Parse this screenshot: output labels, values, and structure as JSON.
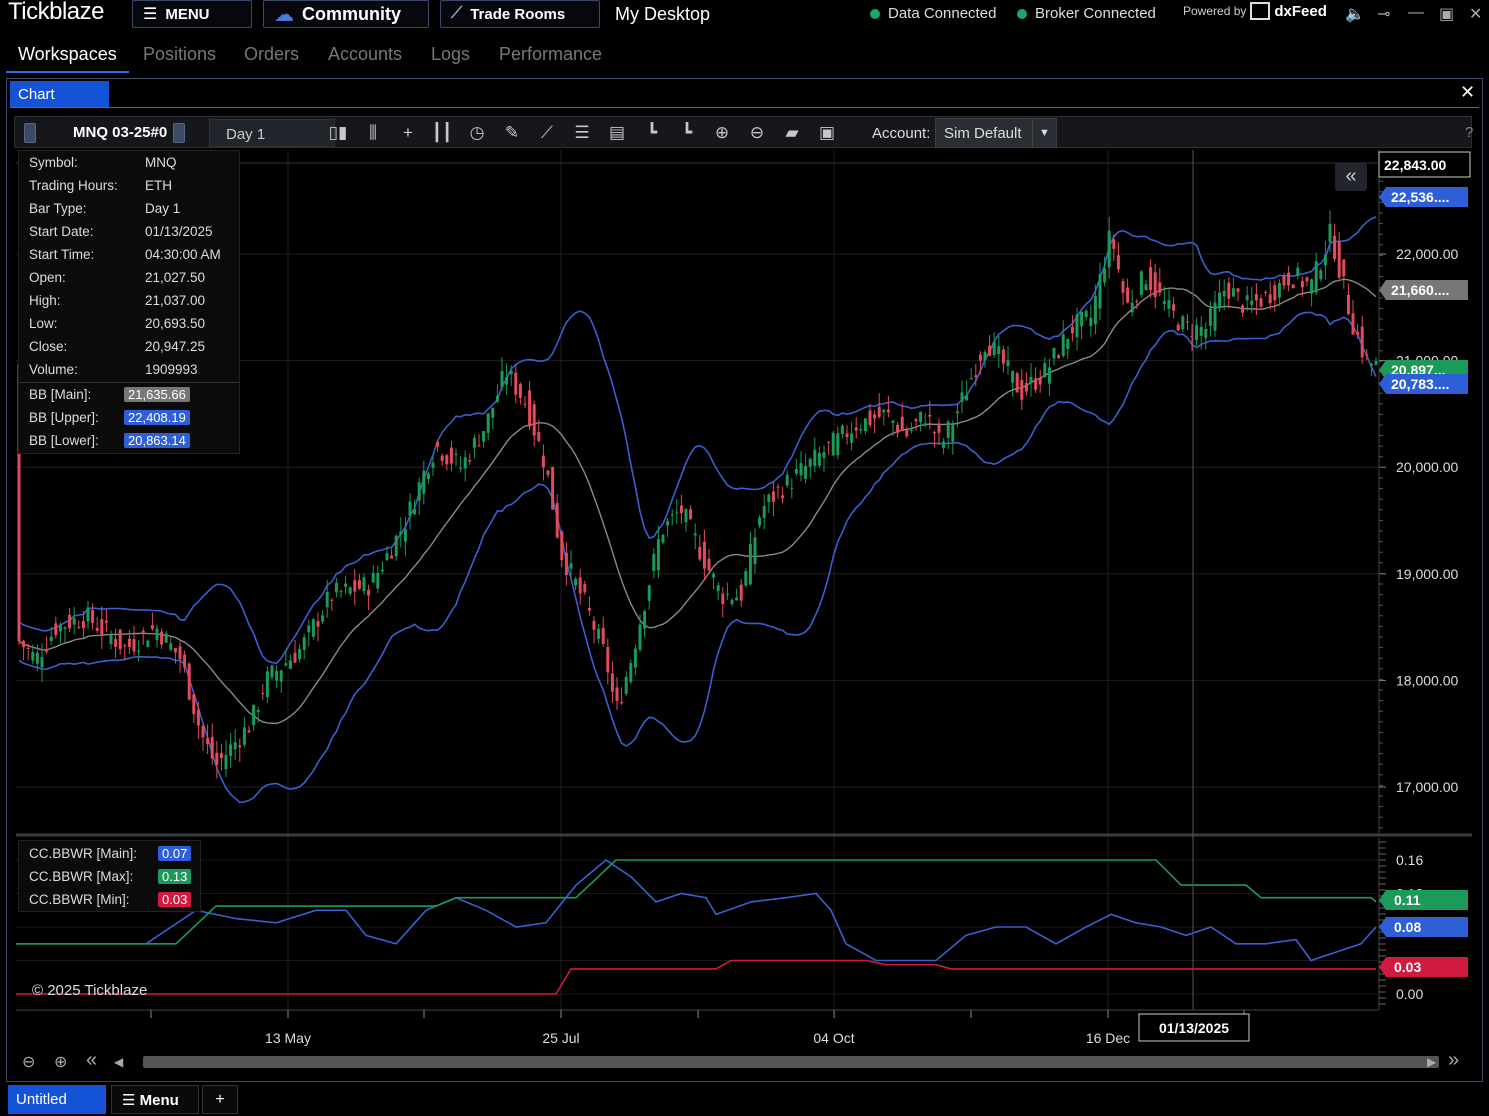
{
  "app": {
    "brand": "Tickblaze",
    "menu_label": "MENU",
    "community_label": "Community",
    "trade_rooms_label": "Trade Rooms",
    "desktop_label": "My Desktop",
    "data_status": "Data Connected",
    "broker_status": "Broker Connected",
    "powered_by": "Powered by",
    "feed_name": "dxFeed"
  },
  "nav_tabs": [
    "Workspaces",
    "Positions",
    "Orders",
    "Accounts",
    "Logs",
    "Performance"
  ],
  "chart_window": {
    "tab_label": "Chart",
    "symbol": "MNQ 03-25#0",
    "period": "Day 1",
    "account_label": "Account:",
    "account_value": "Sim Default",
    "help": "?"
  },
  "info_box": {
    "rows": [
      {
        "label": "Symbol:",
        "value": "MNQ"
      },
      {
        "label": "Trading Hours:",
        "value": "ETH"
      },
      {
        "label": "Bar Type:",
        "value": "Day 1"
      },
      {
        "label": "Start Date:",
        "value": "01/13/2025"
      },
      {
        "label": "Start Time:",
        "value": "04:30:00 AM"
      },
      {
        "label": "Open:",
        "value": "21,027.50"
      },
      {
        "label": "High:",
        "value": "21,037.00"
      },
      {
        "label": "Low:",
        "value": "20,693.50"
      },
      {
        "label": "Close:",
        "value": "20,947.25"
      },
      {
        "label": "Volume:",
        "value": "1909993"
      }
    ],
    "bb": [
      {
        "label": "BB [Main]:",
        "value": "21,635.66",
        "color": "#777777"
      },
      {
        "label": "BB [Upper]:",
        "value": "22,408.19",
        "color": "#2f5fd6"
      },
      {
        "label": "BB [Lower]:",
        "value": "20,863.14",
        "color": "#2f5fd6"
      }
    ]
  },
  "indicator_box": [
    {
      "label": "CC.BBWR [Main]:",
      "value": "0.07",
      "color": "#2f5fd6"
    },
    {
      "label": "CC.BBWR [Max]:",
      "value": "0.13",
      "color": "#1b9a5a"
    },
    {
      "label": "CC.BBWR [Min]:",
      "value": "0.03",
      "color": "#d01a3e"
    }
  ],
  "price_axis": {
    "ticks": [
      "22,000.00",
      "21,000.00",
      "20,000.00",
      "19,000.00",
      "18,000.00",
      "17,000.00"
    ],
    "last_price": "22,843.00",
    "badges": [
      {
        "text": "22,536....",
        "color": "#2f5fd6"
      },
      {
        "text": "21,660....",
        "color": "#777777"
      },
      {
        "text": "20,897...",
        "color": "#1b9a5a"
      },
      {
        "text": "20,783....",
        "color": "#2f5fd6"
      }
    ]
  },
  "indicator_axis": {
    "ticks": [
      "0.16",
      "0.12",
      "0.00"
    ],
    "badges": [
      {
        "text": "0.11",
        "color": "#1b9a5a"
      },
      {
        "text": "0.08",
        "color": "#2f5fd6"
      },
      {
        "text": "0.03",
        "color": "#d01a3e"
      }
    ]
  },
  "time_axis": {
    "labels": [
      "13 May",
      "25 Jul",
      "04 Oct",
      "16 Dec"
    ],
    "crosshair_date": "01/13/2025"
  },
  "copyright": "© 2025 Tickblaze",
  "bottom": {
    "workspace_tab": "Untitled",
    "menu_label": "Menu",
    "add_label": "+"
  },
  "colors": {
    "up": "#1b9a5a",
    "down": "#e24b5b",
    "band": "#3a5fd0",
    "mid": "#8a8a8a",
    "accent": "#1553d6"
  }
}
